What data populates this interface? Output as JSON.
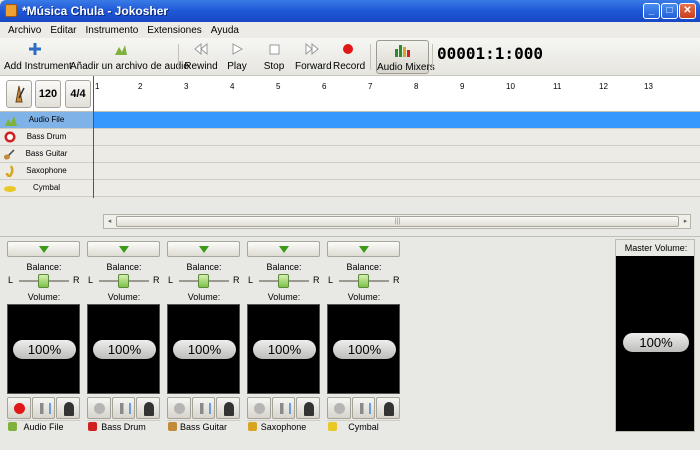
{
  "window": {
    "title": "*Música Chula - Jokosher"
  },
  "menu": [
    "Archivo",
    "Editar",
    "Instrumento",
    "Extensiones",
    "Ayuda"
  ],
  "toolbar": {
    "add_instrument": "Add Instrument",
    "add_audio": "Añadir un archivo de audio",
    "rewind": "Rewind",
    "play": "Play",
    "stop": "Stop",
    "forward": "Forward",
    "record": "Record",
    "audio_mixers": "Audio Mixers",
    "counter": "00001:1:000"
  },
  "timeline": {
    "bpm": "120",
    "signature": "4/4",
    "ruler": [
      "1",
      "2",
      "3",
      "4",
      "5",
      "6",
      "7",
      "8",
      "9",
      "10",
      "11",
      "12",
      "13"
    ]
  },
  "tracks": [
    {
      "name": "Audio File",
      "selected": true,
      "icon": "audio-file-icon"
    },
    {
      "name": "Bass Drum",
      "selected": false,
      "icon": "bass-drum-icon"
    },
    {
      "name": "Bass Guitar",
      "selected": false,
      "icon": "bass-guitar-icon"
    },
    {
      "name": "Saxophone",
      "selected": false,
      "icon": "saxophone-icon"
    },
    {
      "name": "Cymbal",
      "selected": false,
      "icon": "cymbal-icon"
    }
  ],
  "mixers": [
    {
      "name": "Audio File",
      "balance_label": "Balance:",
      "volume_label": "Volume:",
      "volume": "100%",
      "recording": true
    },
    {
      "name": "Bass Drum",
      "balance_label": "Balance:",
      "volume_label": "Volume:",
      "volume": "100%",
      "recording": false
    },
    {
      "name": "Bass Guitar",
      "balance_label": "Balance:",
      "volume_label": "Volume:",
      "volume": "100%",
      "recording": false
    },
    {
      "name": "Saxophone",
      "balance_label": "Balance:",
      "volume_label": "Volume:",
      "volume": "100%",
      "recording": false
    },
    {
      "name": "Cymbal",
      "balance_label": "Balance:",
      "volume_label": "Volume:",
      "volume": "100%",
      "recording": false
    }
  ],
  "balance_left": "L",
  "balance_right": "R",
  "master": {
    "label": "Master Volume:",
    "volume": "100%"
  },
  "colors": {
    "selection": "#3399ff",
    "playhead": "#d21f1f",
    "titlebar": "#1f57d6"
  }
}
